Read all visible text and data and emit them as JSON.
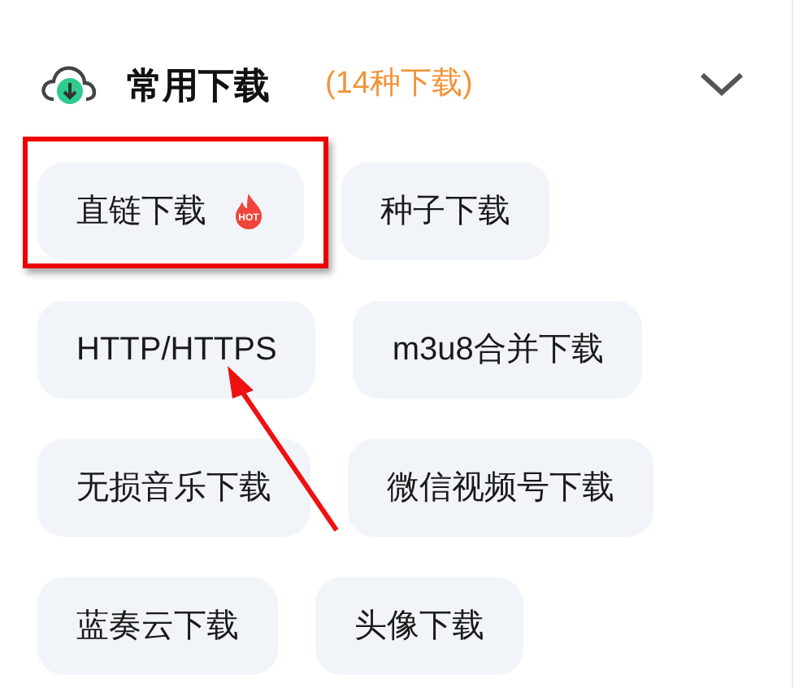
{
  "section": {
    "title": "常用下载",
    "count": "(14种下载)",
    "expanded": true
  },
  "chips": [
    {
      "label": "直链下载",
      "hot": true,
      "hot_label": "HOT",
      "highlighted": true
    },
    {
      "label": "种子下载",
      "hot": false,
      "highlighted": false
    },
    {
      "label": "HTTP/HTTPS",
      "hot": false,
      "highlighted": false
    },
    {
      "label": "m3u8合并下载",
      "hot": false,
      "highlighted": false
    },
    {
      "label": "无损音乐下载",
      "hot": false,
      "highlighted": false
    },
    {
      "label": "微信视频号下载",
      "hot": false,
      "highlighted": false
    },
    {
      "label": "蓝奏云下载",
      "hot": false,
      "highlighted": false
    },
    {
      "label": "头像下载",
      "hot": false,
      "highlighted": false
    }
  ]
}
